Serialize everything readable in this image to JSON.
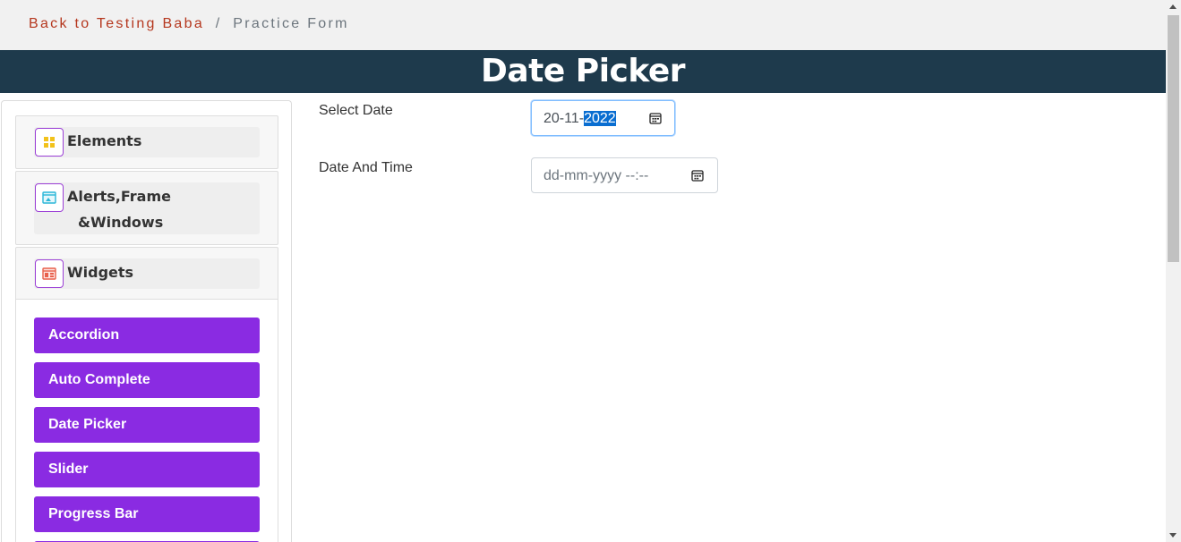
{
  "breadcrumb": {
    "link": "Back to Testing Baba",
    "separator": "/",
    "current": "Practice Form"
  },
  "banner": {
    "title": "Date Picker"
  },
  "sidebar": {
    "sections": [
      {
        "label": "Elements",
        "icon": "elements-grid-icon"
      },
      {
        "label_line1": "Alerts,Frame",
        "label_line2": "&Windows",
        "icon": "window-frame-icon"
      },
      {
        "label": "Widgets",
        "icon": "widgets-calendar-icon"
      }
    ],
    "widgets_menu": [
      "Accordion",
      "Auto Complete",
      "Date Picker",
      "Slider",
      "Progress Bar"
    ]
  },
  "form": {
    "select_date": {
      "label": "Select Date",
      "value_prefix": "20-11-",
      "value_selected": "2022"
    },
    "date_time": {
      "label": "Date And Time",
      "placeholder": "dd-mm-yyyy --:--"
    }
  },
  "colors": {
    "breadcrumb_link": "#b5371e",
    "banner_bg": "#1e3a4c",
    "menu_button": "#8a2be2",
    "icon_border": "#9b3fd6"
  }
}
